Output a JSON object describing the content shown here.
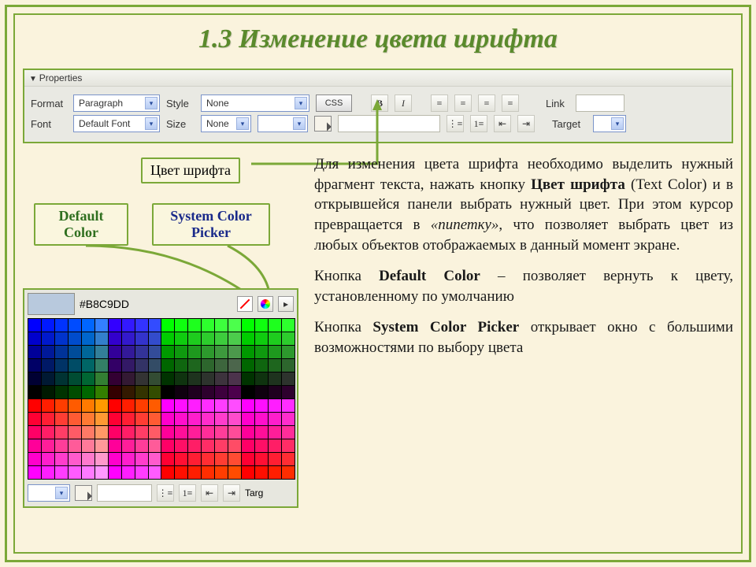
{
  "title": "1.3  Изменение цвета шрифта",
  "panel": {
    "header": "Properties",
    "row1": {
      "format_label": "Format",
      "format_value": "Paragraph",
      "style_label": "Style",
      "style_value": "None",
      "css_button": "CSS",
      "link_label": "Link"
    },
    "row2": {
      "font_label": "Font",
      "font_value": "Default Font",
      "size_label": "Size",
      "size_value": "None",
      "target_label": "Target"
    }
  },
  "callouts": {
    "text_color": "Цвет шрифта",
    "default_color_l1": "Default",
    "default_color_l2": "Color",
    "system_picker_l1": "System Color",
    "system_picker_l2": "Picker"
  },
  "picker": {
    "hex": "#B8C9DD",
    "bottom_label": "Targ"
  },
  "paragraphs": {
    "p1a": "Для изменения цвета шрифта необходимо выделить нужный фрагмент текста, нажать кнопку ",
    "p1b": "Цвет шрифта",
    "p1c": " (Text Color) и в открывшейся панели выбрать нужный цвет. При этом курсор превращается в ",
    "p1d": "«пипетку»",
    "p1e": ", что позволяет выбрать цвет из любых объектов отображаемых в данный момент экране.",
    "p2a": "Кнопка ",
    "p2b": "Default Color",
    "p2c": " – позволяет вернуть к цвету, установленному по умолчанию",
    "p3a": "Кнопка ",
    "p3b": "System Color Picker",
    "p3c": " открывает окно с большими возможностями по выбору цвета"
  }
}
